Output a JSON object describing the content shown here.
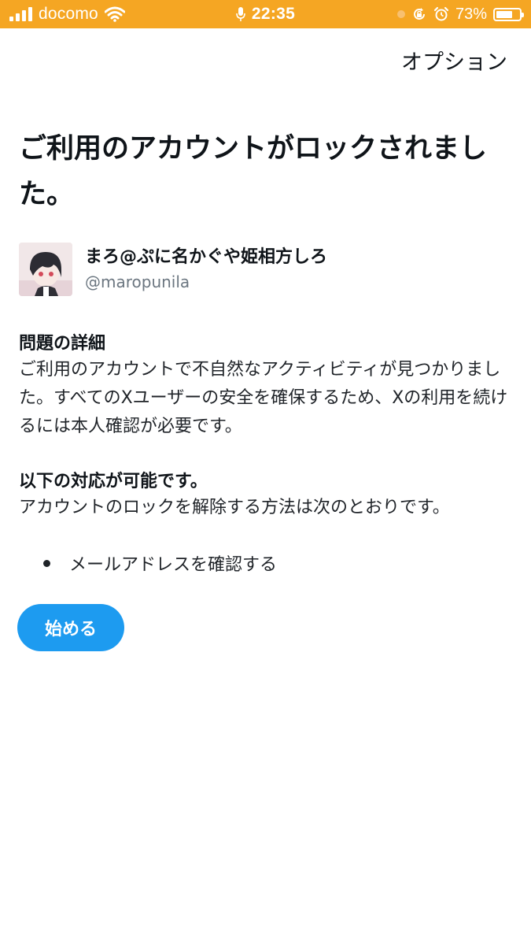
{
  "status_bar": {
    "carrier": "docomo",
    "time": "22:35",
    "battery": "73%",
    "battery_level": 0.73,
    "background_color": "#f5a623",
    "icons": [
      "signal-icon",
      "wifi-icon",
      "microphone-icon",
      "orientation-lock-icon",
      "alarm-icon",
      "battery-icon"
    ]
  },
  "header": {
    "options_label": "オプション"
  },
  "title": "ご利用のアカウントがロックされました。",
  "user": {
    "display_name": "まろ@ぷに名かぐや姫相方しろ",
    "handle": "@maropunila"
  },
  "details": {
    "heading": "問題の詳細",
    "body": "ご利用のアカウントで不自然なアクティビティが見つかりました。すべてのXユーザーの安全を確保するため、Xの利用を続けるには本人確認が必要です。"
  },
  "actions": {
    "heading": "以下の対応が可能です。",
    "body": "アカウントのロックを解除する方法は次のとおりです。",
    "items": [
      "メールアドレスを確認する"
    ]
  },
  "start_button": {
    "label": "始める",
    "color": "#1d9bf0"
  }
}
